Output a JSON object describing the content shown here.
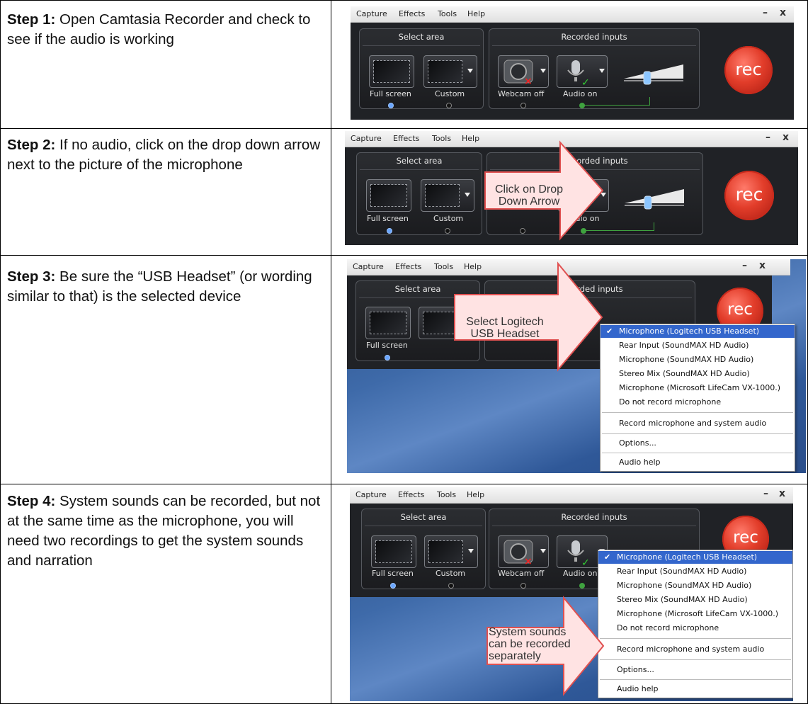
{
  "steps": [
    {
      "label": "Step 1:",
      "text": " Open Camtasia Recorder and check to see if the audio is working"
    },
    {
      "label": "Step 2:",
      "text": " If no audio, click on the drop down arrow next to the picture of the microphone"
    },
    {
      "label": "Step 3:",
      "text": " Be sure the “USB Headset” (or wording similar to that) is the selected device"
    },
    {
      "label": "Step 4:",
      "text": " System sounds can be recorded, but not at the same time as the microphone, you will need two recordings to get the system sounds and narration"
    }
  ],
  "recorder": {
    "menu": [
      "Capture",
      "Effects",
      "Tools",
      "Help"
    ],
    "window_controls": {
      "minimize": "–",
      "close": "x"
    },
    "select_area_title": "Select area",
    "recorded_inputs_title": "Recorded inputs",
    "full_screen_label": "Full screen",
    "custom_label": "Custom",
    "webcam_label": "Webcam off",
    "audio_label": "Audio on",
    "rec_label": "rec"
  },
  "callouts": {
    "step2": "Click on Drop Down Arrow",
    "step3": "Select Logitech USB Headset",
    "step4": "System sounds can be recorded separately"
  },
  "audio_menu": {
    "items": [
      "Microphone (Logitech USB Headset)",
      "Rear Input (SoundMAX HD Audio)",
      "Microphone (SoundMAX HD Audio)",
      "Stereo Mix (SoundMAX HD Audio)",
      "Microphone (Microsoft LifeCam VX-1000.)",
      "Do not record microphone"
    ],
    "record_both": "Record microphone and system audio",
    "options": "Options...",
    "help": "Audio help",
    "selected_index": 0
  },
  "colors": {
    "rec_red": "#e23d2a",
    "menu_highlight": "#3366cc",
    "callout_fill": "#ffd7d7",
    "callout_stroke": "#e04040"
  }
}
